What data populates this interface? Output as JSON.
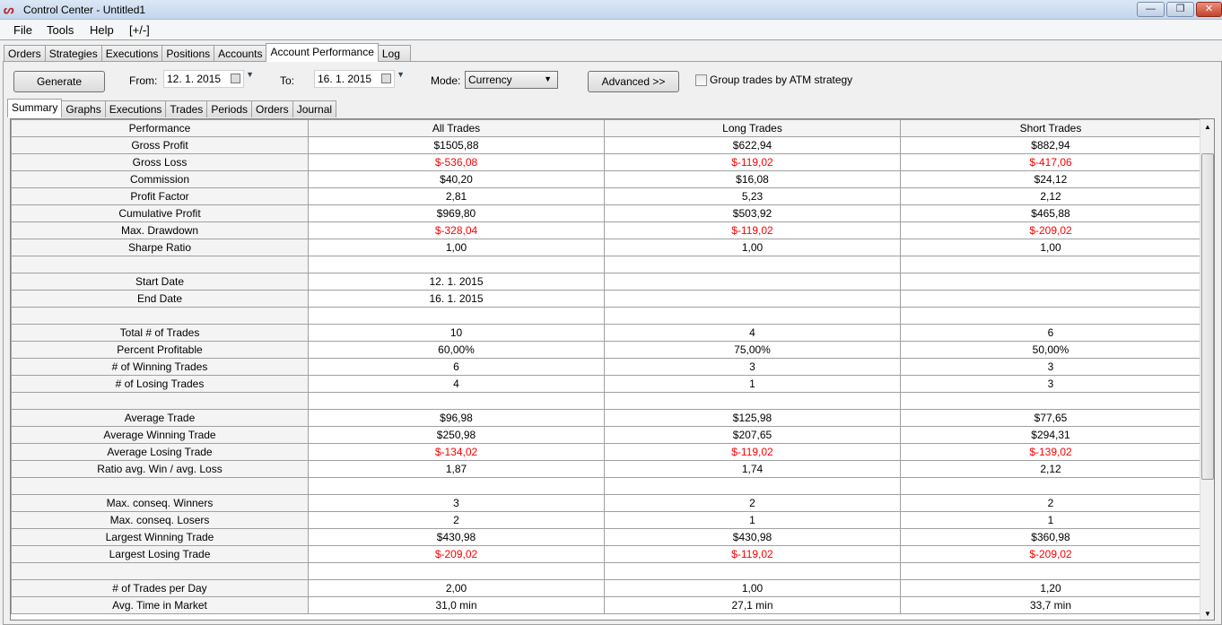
{
  "window": {
    "title": "Control Center - Untitled1",
    "min": "—",
    "restore": "❐",
    "close": "✕"
  },
  "menu": [
    "File",
    "Tools",
    "Help",
    "[+/-]"
  ],
  "outer_tabs": [
    "Orders",
    "Strategies",
    "Executions",
    "Positions",
    "Accounts",
    "Account Performance",
    "Log"
  ],
  "toolbar": {
    "generate": "Generate",
    "from_label": "From:",
    "from_value": "12.  1. 2015",
    "to_label": "To:",
    "to_value": "16.  1. 2015",
    "mode_label": "Mode:",
    "mode_value": "Currency",
    "advanced": "Advanced >>",
    "group_label": "Group trades by ATM strategy"
  },
  "inner_tabs": [
    "Summary",
    "Graphs",
    "Executions",
    "Trades",
    "Periods",
    "Orders",
    "Journal"
  ],
  "table": {
    "headers": [
      "Performance",
      "All Trades",
      "Long Trades",
      "Short Trades"
    ],
    "rows": [
      [
        "Gross Profit",
        "$1505,88",
        "$622,94",
        "$882,94"
      ],
      [
        "Gross Loss",
        "$-536,08",
        "$-119,02",
        "$-417,06"
      ],
      [
        "Commission",
        "$40,20",
        "$16,08",
        "$24,12"
      ],
      [
        "Profit Factor",
        "2,81",
        "5,23",
        "2,12"
      ],
      [
        "Cumulative Profit",
        "$969,80",
        "$503,92",
        "$465,88"
      ],
      [
        "Max. Drawdown",
        "$-328,04",
        "$-119,02",
        "$-209,02"
      ],
      [
        "Sharpe Ratio",
        "1,00",
        "1,00",
        "1,00"
      ],
      [
        "",
        "",
        "",
        ""
      ],
      [
        "Start Date",
        "12. 1. 2015",
        "",
        ""
      ],
      [
        "End Date",
        "16. 1. 2015",
        "",
        ""
      ],
      [
        "",
        "",
        "",
        ""
      ],
      [
        "Total # of Trades",
        "10",
        "4",
        "6"
      ],
      [
        "Percent Profitable",
        "60,00%",
        "75,00%",
        "50,00%"
      ],
      [
        "# of Winning Trades",
        "6",
        "3",
        "3"
      ],
      [
        "# of Losing Trades",
        "4",
        "1",
        "3"
      ],
      [
        "",
        "",
        "",
        ""
      ],
      [
        "Average Trade",
        "$96,98",
        "$125,98",
        "$77,65"
      ],
      [
        "Average Winning Trade",
        "$250,98",
        "$207,65",
        "$294,31"
      ],
      [
        "Average Losing Trade",
        "$-134,02",
        "$-119,02",
        "$-139,02"
      ],
      [
        "Ratio avg. Win / avg. Loss",
        "1,87",
        "1,74",
        "2,12"
      ],
      [
        "",
        "",
        "",
        ""
      ],
      [
        "Max. conseq. Winners",
        "3",
        "2",
        "2"
      ],
      [
        "Max. conseq. Losers",
        "2",
        "1",
        "1"
      ],
      [
        "Largest Winning Trade",
        "$430,98",
        "$430,98",
        "$360,98"
      ],
      [
        "Largest Losing Trade",
        "$-209,02",
        "$-119,02",
        "$-209,02"
      ],
      [
        "",
        "",
        "",
        ""
      ],
      [
        "# of Trades per Day",
        "2,00",
        "1,00",
        "1,20"
      ],
      [
        "Avg. Time in Market",
        "31,0 min",
        "27,1 min",
        "33,7 min"
      ]
    ]
  },
  "colors": {
    "negative": "#ff0000"
  }
}
